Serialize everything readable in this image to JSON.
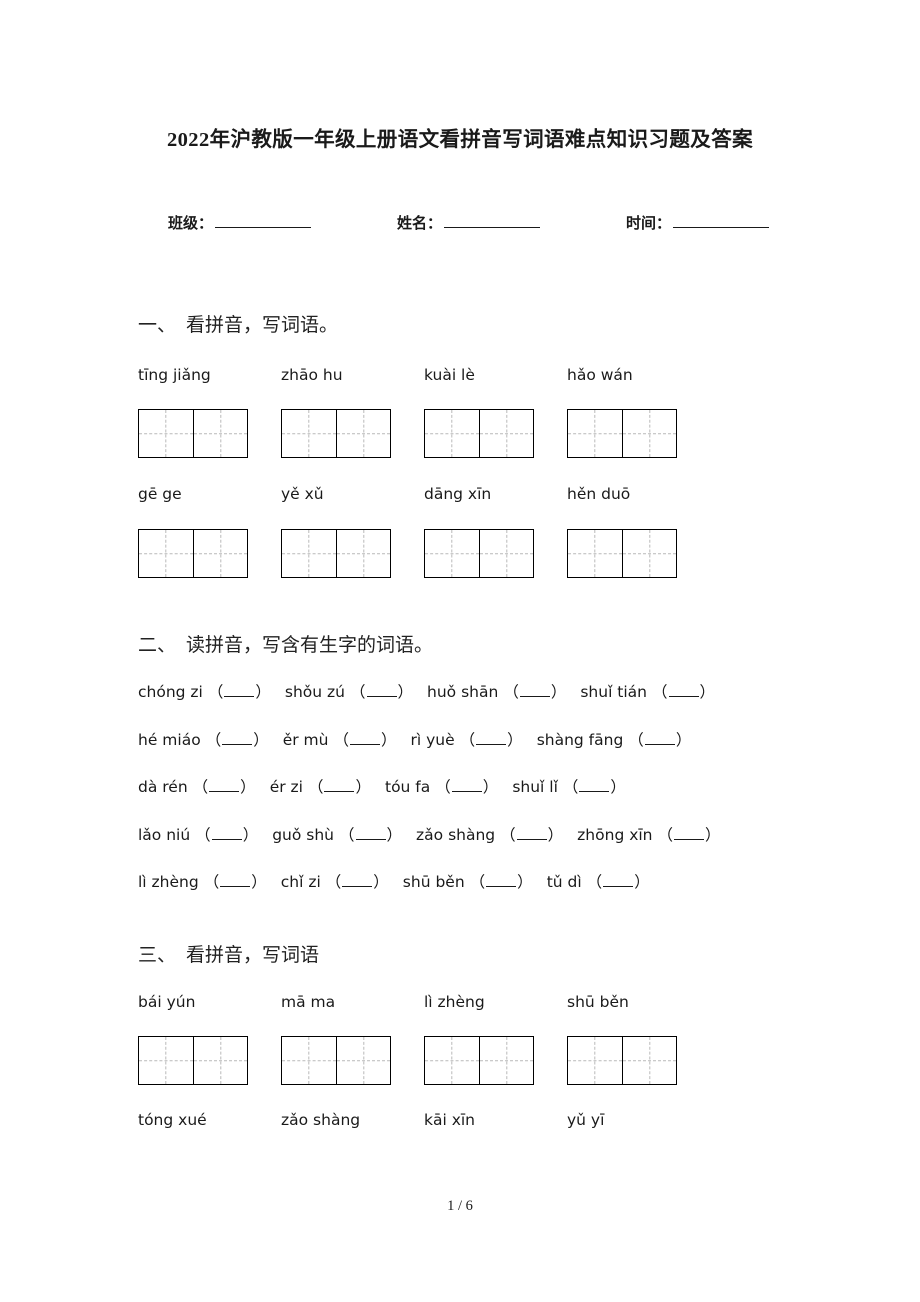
{
  "document": {
    "title": "2022年沪教版一年级上册语文看拼音写词语难点知识习题及答案",
    "footer_page": "1 / 6"
  },
  "info_line": {
    "class_label": "班级：",
    "name_label": "姓名：",
    "time_label": "时间："
  },
  "sections": [
    {
      "num": "一、",
      "heading": "看拼音，写词语。",
      "pinyin_rows": [
        [
          "tīng  jiǎng",
          "zhāo  hu",
          "kuài  lè",
          "hǎo  wán"
        ],
        [
          "gē    ge",
          "yě  xǔ",
          "dāng xīn",
          "hěn  duō"
        ]
      ]
    },
    {
      "num": "二、",
      "heading": "读拼音，写含有生字的词语。",
      "fill_rows": [
        [
          "chóng zi",
          "shǒu zú",
          "huǒ shān",
          "shuǐ tián"
        ],
        [
          "hé miáo",
          "ěr mù",
          "rì yuè",
          "shàng fāng"
        ],
        [
          "dà rén",
          "ér zi",
          "tóu fa",
          "shuǐ lǐ"
        ],
        [
          "lǎo niú",
          "guǒ shù",
          "zǎo shàng",
          "zhōng xīn"
        ],
        [
          "lì zhèng",
          "chǐ zi",
          "shū běn",
          "tǔ dì"
        ]
      ]
    },
    {
      "num": "三、",
      "heading": "看拼音，写词语",
      "pinyin_rows": [
        [
          "bái   yún",
          "mā  ma",
          "lì  zhèng",
          "shū běn"
        ],
        [
          "tóng  xué",
          "zǎo  shàng",
          "kāi  xīn",
          "yǔ   yī"
        ]
      ]
    }
  ]
}
